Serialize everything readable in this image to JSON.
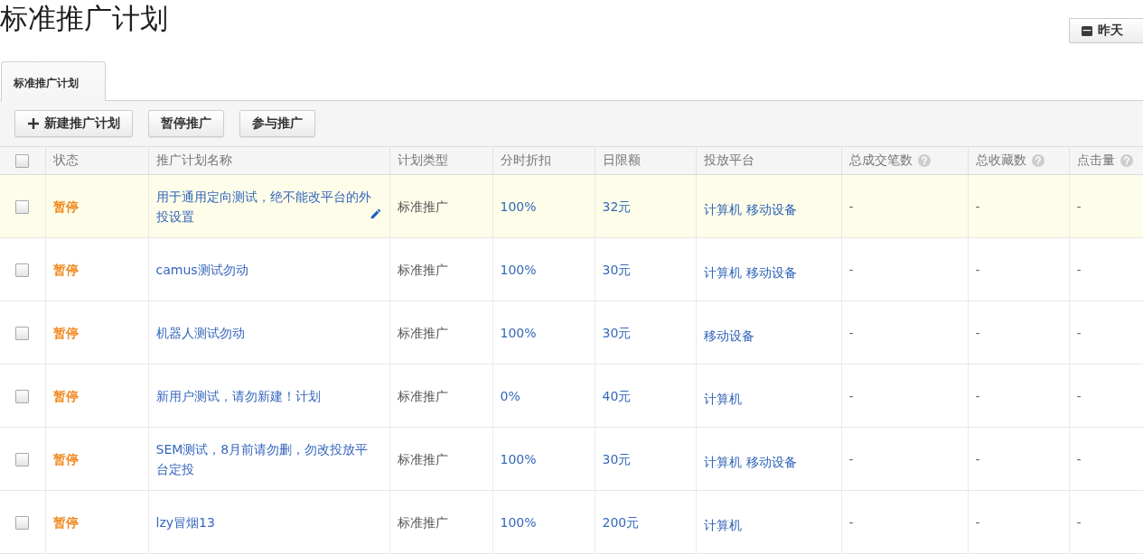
{
  "page": {
    "title": "标准推广计划"
  },
  "date_button": {
    "label": "昨天"
  },
  "tabs": [
    {
      "label": "标准推广计划",
      "selected": true
    }
  ],
  "toolbar": [
    {
      "label": "新建推广计划",
      "kind": "add"
    },
    {
      "label": "暂停推广",
      "kind": "plain"
    },
    {
      "label": "参与推广",
      "kind": "plain"
    }
  ],
  "table": {
    "select_all": {
      "checked": false
    },
    "columns": [
      {
        "label": "状态",
        "help": false
      },
      {
        "label": "推广计划名称",
        "help": false
      },
      {
        "label": "计划类型",
        "help": false
      },
      {
        "label": "分时折扣",
        "help": false
      },
      {
        "label": "日限额",
        "help": false
      },
      {
        "label": "投放平台",
        "help": false
      },
      {
        "label": "总成交笔数",
        "help": true
      },
      {
        "label": "总收藏数",
        "help": true
      },
      {
        "label": "点击量",
        "help": true
      }
    ],
    "rows": [
      {
        "checked": false,
        "highlighted": true,
        "status": "暂停",
        "name": "用于通用定向测试，绝不能改平台的外投设置",
        "edit_icon": true,
        "type": "标准推广",
        "discount": "100%",
        "daily_limit": "32元",
        "platforms": [
          "计算机",
          "移动设备"
        ],
        "transactions": "-",
        "favorites": "-",
        "clicks": "-"
      },
      {
        "checked": false,
        "highlighted": false,
        "status": "暂停",
        "name": "camus测试勿动",
        "edit_icon": false,
        "type": "标准推广",
        "discount": "100%",
        "daily_limit": "30元",
        "platforms": [
          "计算机",
          "移动设备"
        ],
        "transactions": "-",
        "favorites": "-",
        "clicks": "-"
      },
      {
        "checked": false,
        "highlighted": false,
        "status": "暂停",
        "name": "机器人测试勿动",
        "edit_icon": false,
        "type": "标准推广",
        "discount": "100%",
        "daily_limit": "30元",
        "platforms": [
          "移动设备"
        ],
        "transactions": "-",
        "favorites": "-",
        "clicks": "-"
      },
      {
        "checked": false,
        "highlighted": false,
        "status": "暂停",
        "name": "新用户测试，请勿新建！计划",
        "edit_icon": false,
        "type": "标准推广",
        "discount": "0%",
        "daily_limit": "40元",
        "platforms": [
          "计算机"
        ],
        "transactions": "-",
        "favorites": "-",
        "clicks": "-"
      },
      {
        "checked": false,
        "highlighted": false,
        "status": "暂停",
        "name": "SEM测试，8月前请勿删，勿改投放平台定投",
        "edit_icon": false,
        "type": "标准推广",
        "discount": "100%",
        "daily_limit": "30元",
        "platforms": [
          "计算机",
          "移动设备"
        ],
        "transactions": "-",
        "favorites": "-",
        "clicks": "-"
      },
      {
        "checked": false,
        "highlighted": false,
        "status": "暂停",
        "name": "lzy冒烟13",
        "edit_icon": false,
        "type": "标准推广",
        "discount": "100%",
        "daily_limit": "200元",
        "platforms": [
          "计算机"
        ],
        "transactions": "-",
        "favorites": "-",
        "clicks": "-"
      }
    ]
  }
}
